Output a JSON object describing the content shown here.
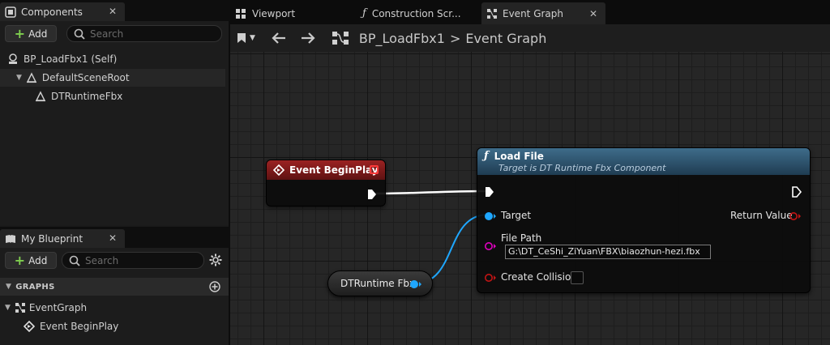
{
  "components_panel": {
    "tab_label": "Components",
    "add_label": "Add",
    "search_placeholder": "Search",
    "tree": [
      {
        "label": "BP_LoadFbx1 (Self)",
        "icon": "blueprint-self-icon"
      },
      {
        "label": "DefaultSceneRoot",
        "icon": "scene-root-icon"
      },
      {
        "label": "DTRuntimeFbx",
        "icon": "component-icon"
      }
    ]
  },
  "my_blueprint_panel": {
    "tab_label": "My Blueprint",
    "add_label": "Add",
    "search_placeholder": "Search",
    "sections": [
      {
        "label": "GRAPHS",
        "items": [
          {
            "label": "EventGraph",
            "icon": "event-graph-icon"
          },
          {
            "label": "Event BeginPlay",
            "icon": "event-diamond-icon"
          }
        ]
      }
    ]
  },
  "editor": {
    "tabs": [
      {
        "label": "Viewport",
        "icon": "viewport-icon",
        "active": false
      },
      {
        "label": "Construction Scr...",
        "icon": "function-icon",
        "active": false
      },
      {
        "label": "Event Graph",
        "icon": "event-graph-icon",
        "active": true
      }
    ],
    "breadcrumb": {
      "blueprint": "BP_LoadFbx1",
      "separator": ">",
      "graph": "Event Graph"
    }
  },
  "graph": {
    "event_node": {
      "title": "Event BeginPlay",
      "header_color": "#8b1e1e"
    },
    "function_node": {
      "title": "Load File",
      "subtitle": "Target is DT Runtime Fbx Component",
      "header_color": "#2e5670",
      "pins": {
        "target": "Target",
        "file_path": "File Path",
        "file_path_value": "G:\\DT_CeShi_ZiYuan\\FBX\\biaozhun-hezi.fbx",
        "create_collision": "Create Collision",
        "create_collision_checked": false,
        "return_value": "Return Value"
      }
    },
    "variable_node": {
      "label": "DTRuntime Fbx"
    }
  },
  "colors": {
    "object_pin": "#1fa7ff",
    "string_pin": "#e000c0",
    "bool_pin": "#9a0000",
    "exec_wire": "#ffffff",
    "add_plus": "#7fcf4f"
  }
}
